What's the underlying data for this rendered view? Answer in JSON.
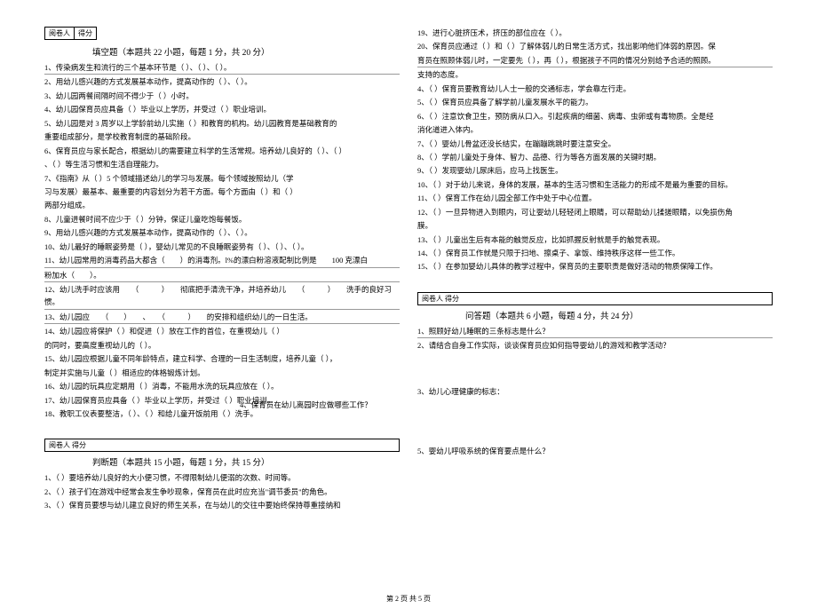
{
  "graderBox": {
    "a": "阅卷人",
    "b": "得分"
  },
  "graderBoxWide": "阅卷人 得分",
  "fill": {
    "title": "填空题（本题共 22 小题，每题 1 分，共 20 分）",
    "items": [
      "1、传染病发生和流行的三个基本环节是（ ）、（ ）、（ ）。",
      "2、用幼儿感兴趣的方式发展基本动作，提高动作的（ ）、（ ）。",
      "3、幼儿园两餐间隔时间不得少于（ ）小时。",
      "4、幼儿园保育员应具备（ ）毕业以上学历，并受过（ ）职业培训。",
      "5、幼儿园是对 3 周岁以上学龄前幼儿实施（ ）和教育的机构。幼儿园教育是基础教育的",
      "重要组成部分，是学校教育制度的基础阶段。",
      "6、保育员应与家长配合，根据幼儿的需要建立科学的生活常规。培养幼儿良好的（ ）、（ ）",
      "、（ ）等生活习惯和生活自理能力。",
      "7、《指南》从（ ）5 个领域描述幼儿的学习与发展。每个领域按照幼儿（学",
      "习与发展）最基本、最重要的内容划分为若干方面。每个方面由（ ）和（ ）",
      "两部分组成。",
      "8、儿童进餐时间不应少于（ ）分钟，保证儿童吃饱每餐饭。",
      "9、用幼儿感兴趣的方式发展基本动作，提高动作的（ ）、（ ）。",
      "10、幼儿最好的睡眠姿势是（ ），婴幼儿常见的不良睡眠姿势有（ ）、（ ）、（ ）。",
      "11、幼儿园常用的消毒药品大都含（　　）的消毒剂。l%的漂白粉溶液配制比例是　　100 克漂白",
      "粉加水（　　）。",
      "12、幼儿洗手时应该用　　（　　　）　　彻底把手清洗干净，并培养幼儿　　（　　　）　　洗手的良好习惯。",
      "13、幼儿园应　　（　　）　　、　　（　　　）　　的安排和组织幼儿的一日生活。",
      "14、幼儿园应将保护（ ）和促进（ ）放在工作的首位，在重视幼儿（ ）",
      "的同时，要高度重视幼儿的（ ）。",
      "15、幼儿园应根据儿童不同年龄特点，建立科学、合理的一日生活制度，培养儿童（ ），",
      "制定并实施与儿童（ ）相适应的体格锻炼计划。",
      "16、幼儿园的玩具应定期用（ ）消毒，不能用水洗的玩具应放在（ ）。",
      "17、幼儿园保育员应具备（ ）毕业以上学历，并受过（ ）职业培训。",
      "18、教职工仪表要整洁，（ ）、（ ）和给儿童开饭前用（ ）洗手。"
    ]
  },
  "judge": {
    "title": "判断题（本题共 15 小题，每题 1 分，共 15 分）",
    "left": [
      "1、（ ）要培养幼儿良好的大小便习惯，不得限制幼儿便溺的次数、时间等。",
      "2、（ ）孩子们在游戏中经常会发生争吵现象，保育员在此时应充当\"调节委员\"的角色。",
      "3、（ ）保育员要想与幼儿建立良好的师生关系，在与幼儿的交往中要始终保持尊重接纳和"
    ],
    "firstRight": "19、进行心脏挤压术，挤压的部位应在（ ）。",
    "right": [
      "20、保育员应通过（ ）和（ ）了解体弱儿的日常生活方式，找出影响他们体弱的原因。保",
      "育员在照顾体弱儿时，一定要先（ ），再（ ），根据孩子不同的情况分别给予合适的照顾。",
      "支持的态度。",
      "4、（ ）保育员要教育幼儿人士一般的交通标志，学会靠左行走。",
      "5、（ ）保育员应具备了解学前儿童发展水平的能力。",
      "6、（ ）注意饮食卫生，预防病从口入。引起疾病的细菌、病毒、虫卵或有毒物质。全是经",
      "消化道进入体内。",
      "7、（ ）婴幼儿骨盆还没长结实，在蹦蹦跳跳时要注意安全。",
      "8、（ ）学前儿童处于身体、智力、品德、行为等各方面发展的关键时期。",
      "9、（ ）发现婴幼儿尿床后，应马上找医生。",
      "10、（ ）对于幼儿来说，身体的发展，基本的生活习惯和生活能力的形成不是最为重要的目标。",
      "11、（ ）保育工作在幼儿园全部工作中处于中心位置。",
      "12、（ ）一旦异物进入到眼内，可让婴幼儿轻轻闭上眼睛，可以帮助幼儿揉搓眼睛，以免损伤角",
      "膜。",
      "13、（ ）儿童出生后有本能的触觉反应，比如抓握反射就是手的触觉表现。",
      "14、（ ）保育员工作就是只限于扫地、擦桌子、拿饭、维持秩序这样一些工作。",
      "15、（ ）在参加婴幼儿具体的教学过程中，保育员的主要职责是做好活动的物质保障工作。"
    ]
  },
  "qa": {
    "title": "问答题（本题共 6 小题，每题 4 分，共 24 分）",
    "items": [
      "1、照顾好幼儿睡眠的三条标志是什么？",
      "2、请结合自身工作实际，谈谈保育员应如何指导婴幼儿的游戏和教学活动？",
      "3、幼儿心理健康的标志：",
      "4、保育员在幼儿离园时应做哪些工作？",
      "5、婴幼儿呼吸系统的保育要点是什么？"
    ]
  },
  "footer": "第 2 页 共 5 页"
}
